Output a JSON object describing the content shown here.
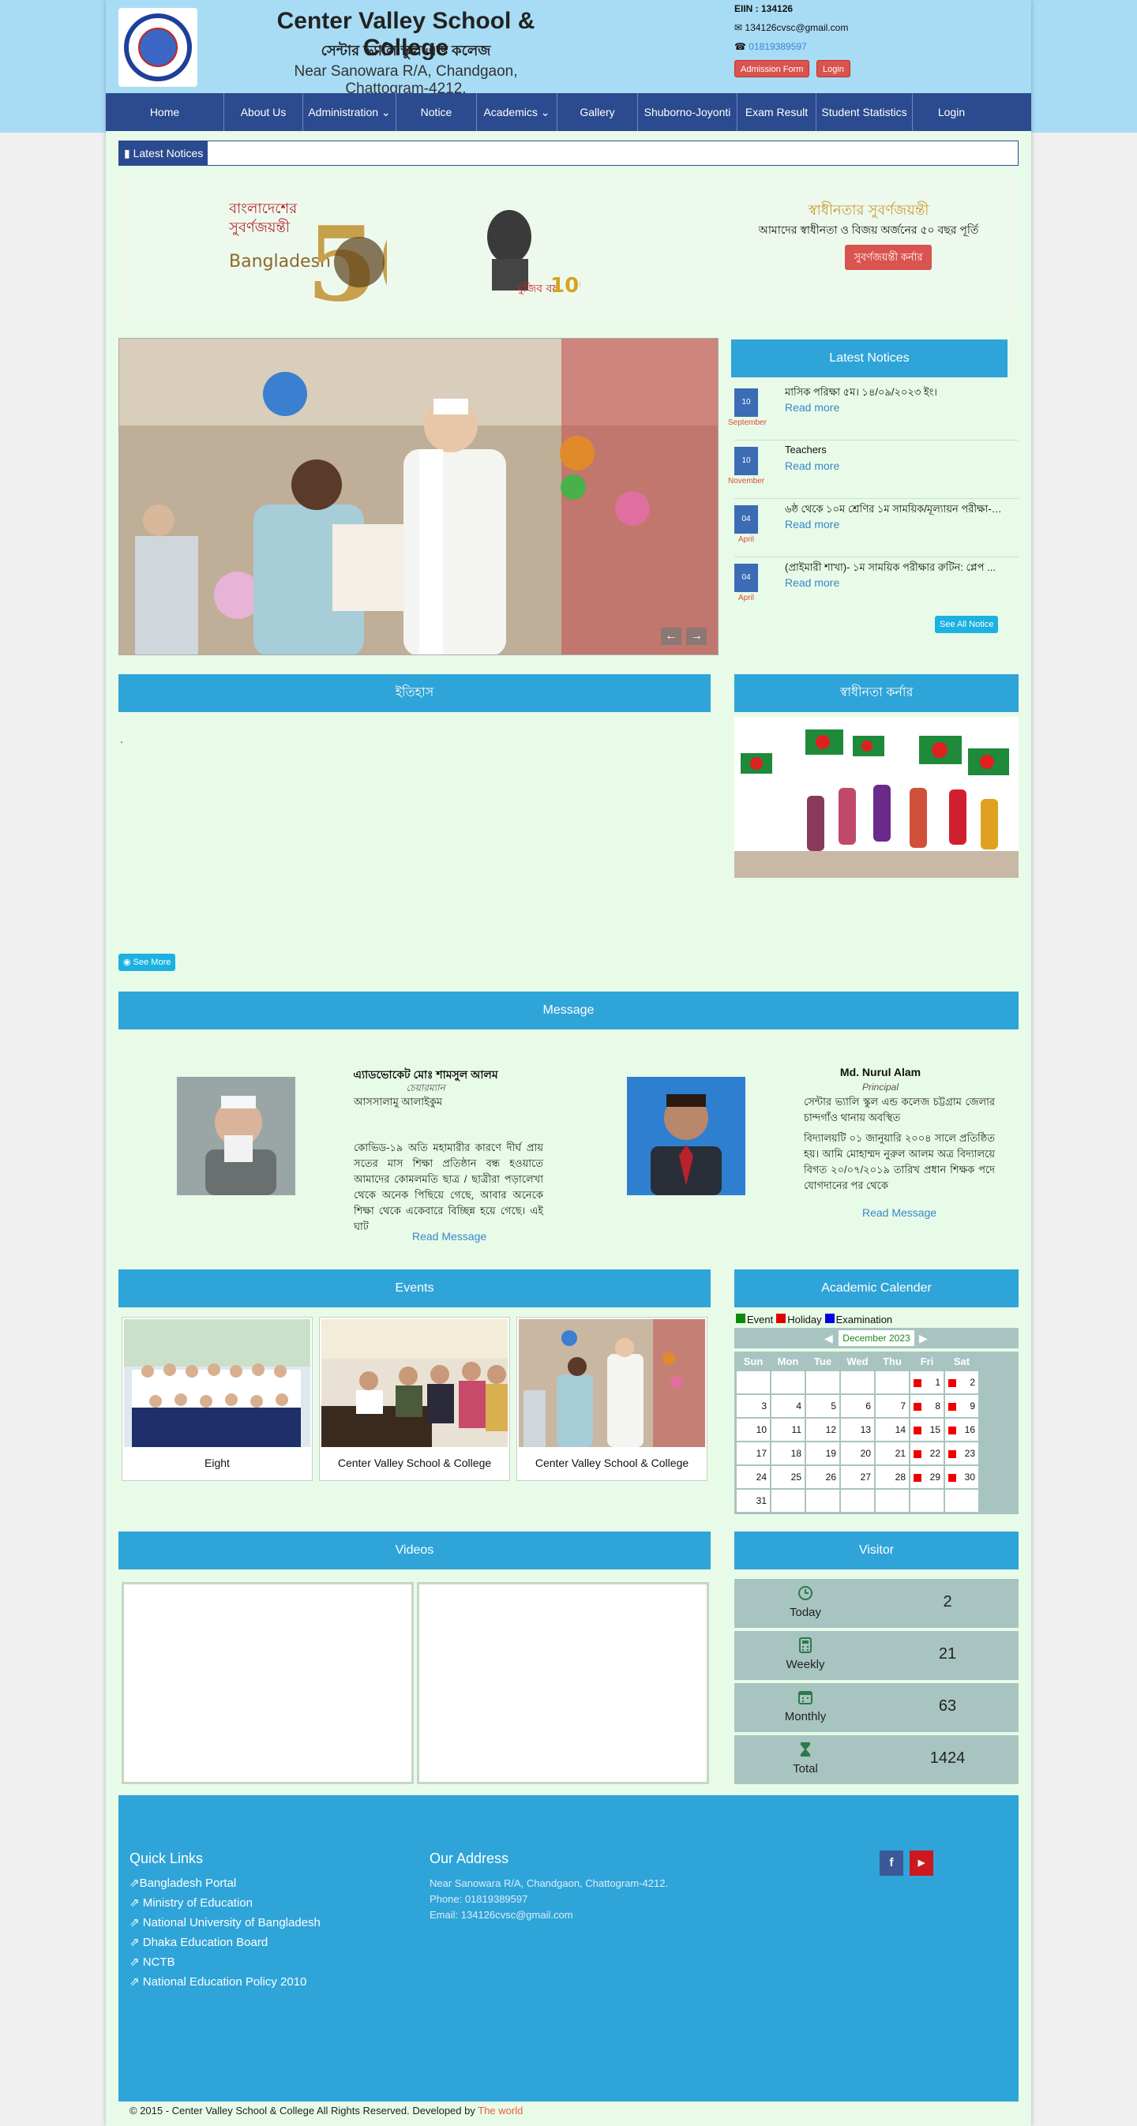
{
  "header": {
    "school_name_en": "Center Valley School & College",
    "school_name_bn": "সেন্টার ভ্যালি স্কুল এন্ড কলেজ",
    "address": "Near Sanowara R/A, Chandgaon, Chattogram-4212.",
    "eiin": "EIIN : 134126",
    "email": "134126cvsc@gmail.com",
    "phone": "01819389597",
    "admission_btn": "Admission Form",
    "login_btn": "Login"
  },
  "nav": [
    {
      "label": "Home"
    },
    {
      "label": "About Us"
    },
    {
      "label": "Administration ⌄"
    },
    {
      "label": "Notice"
    },
    {
      "label": "Academics ⌄"
    },
    {
      "label": "Gallery"
    },
    {
      "label": "Shuborno-Joyonti"
    },
    {
      "label": "Exam Result"
    },
    {
      "label": "Student Statistics"
    },
    {
      "label": "Login"
    }
  ],
  "marquee": {
    "label": "Latest Notices"
  },
  "banner": {
    "bd50_text1": "বাংলাদেশের",
    "bd50_text2": "সুবর্ণজয়ন্তী",
    "bd50_text3": "Bangladesh",
    "bd50_number": "50",
    "mujib_text": "মুজিব বর্ষ",
    "mujib_num": "100",
    "title": "স্বাধীনতার সুবর্ণজয়ন্তী",
    "subtitle": "আমাদের স্বাধীনতা ও বিজয় অর্জনের ৫০ বছর পূর্তি",
    "button": "সুবর্ণজয়ন্তী কর্নার"
  },
  "latest_notices": {
    "title": "Latest Notices",
    "items": [
      {
        "day": "10",
        "month": "September",
        "title": "মাসিক পরিক্ষা ৫ম। ১৪/০৯/২০২৩ ইং।",
        "link": "Read more"
      },
      {
        "day": "10",
        "month": "November",
        "title": "Teachers",
        "link": "Read more"
      },
      {
        "day": "04",
        "month": "April",
        "title": "৬ষ্ঠ থেকে ১০ম শ্রেণির ১ম সাময়িক/মূল্যায়ন পরীক্ষা-২ ...",
        "link": "Read more"
      },
      {
        "day": "04",
        "month": "April",
        "title": "(প্রাইমারী শাখা)- ১ম সাময়িক পরীক্ষার রুটিন: প্লেপ ...",
        "link": "Read more"
      }
    ],
    "see_all": "See All Notice"
  },
  "history": {
    "title": "ইতিহাস",
    "text": ".",
    "see_more": "See More"
  },
  "freedom": {
    "title": "স্বাধীনতা কর্নার"
  },
  "message": {
    "title": "Message",
    "chairman": {
      "name": "এ্যাডভোকেট মোঃ শামসুল আলম",
      "role": "চেয়ারম্যান",
      "greeting": "আসসালামু আলাইকুম",
      "text": "কোভিড-১৯ অতি মহামারীর কারণে দীর্ঘ প্রায় সতের মাস শিক্ষা প্রতিষ্ঠান বন্ধ হওয়াতে আমাদের কোমলমতি ছাত্র / ছাত্রীরা পড়ালেখা থেকে অনেক পিছিয়ে গেছে, আবার অনেকে শিক্ষা থেকে একেবারে বিচ্ছিন্ন হয়ে গেছে। এই ঘাট",
      "link": "Read Message"
    },
    "principal": {
      "name": "Md. Nurul Alam",
      "role": "Principal",
      "intro": "সেন্টার ভ্যালি স্কুল এন্ড কলেজ চট্টগ্রাম জেলার চান্দগাঁও থানায় অবস্থিত",
      "text": "বিদ্যালয়টি ০১ জানুয়ারি ২০০৪ সালে প্রতিষ্ঠিত হয়। আমি মোহাম্মদ নুরুল আলম অত্র বিদ্যালয়ে বিগত ২০/০৭/২০১৯ তারিখ প্রধান শিক্ষক পদে যোগদানের পর থেকে",
      "link": "Read Message"
    }
  },
  "events": {
    "title": "Events",
    "items": [
      {
        "caption": "Eight"
      },
      {
        "caption": "Center Valley School & College"
      },
      {
        "caption": "Center Valley School & College"
      }
    ]
  },
  "calendar": {
    "title": "Academic Calender",
    "legend": [
      {
        "label": "Event",
        "color": "#0a8a0a"
      },
      {
        "label": "Holiday",
        "color": "#e00000"
      },
      {
        "label": "Examination",
        "color": "#0000e0"
      }
    ],
    "month": "December 2023",
    "days": [
      "Sun",
      "Mon",
      "Tue",
      "Wed",
      "Thu",
      "Fri",
      "Sat"
    ],
    "weeks": [
      [
        {
          "d": ""
        },
        {
          "d": ""
        },
        {
          "d": ""
        },
        {
          "d": ""
        },
        {
          "d": ""
        },
        {
          "d": "1",
          "h": true
        },
        {
          "d": "2",
          "h": true
        }
      ],
      [
        {
          "d": "3"
        },
        {
          "d": "4"
        },
        {
          "d": "5"
        },
        {
          "d": "6"
        },
        {
          "d": "7"
        },
        {
          "d": "8",
          "h": true
        },
        {
          "d": "9",
          "h": true
        }
      ],
      [
        {
          "d": "10"
        },
        {
          "d": "11"
        },
        {
          "d": "12"
        },
        {
          "d": "13"
        },
        {
          "d": "14"
        },
        {
          "d": "15",
          "h": true
        },
        {
          "d": "16",
          "h": true
        }
      ],
      [
        {
          "d": "17"
        },
        {
          "d": "18"
        },
        {
          "d": "19"
        },
        {
          "d": "20"
        },
        {
          "d": "21"
        },
        {
          "d": "22",
          "h": true
        },
        {
          "d": "23",
          "h": true
        }
      ],
      [
        {
          "d": "24"
        },
        {
          "d": "25"
        },
        {
          "d": "26"
        },
        {
          "d": "27"
        },
        {
          "d": "28"
        },
        {
          "d": "29",
          "h": true
        },
        {
          "d": "30",
          "h": true
        }
      ],
      [
        {
          "d": "31"
        },
        {
          "d": ""
        },
        {
          "d": ""
        },
        {
          "d": ""
        },
        {
          "d": ""
        },
        {
          "d": ""
        },
        {
          "d": ""
        }
      ]
    ]
  },
  "videos": {
    "title": "Videos"
  },
  "visitor": {
    "title": "Visitor",
    "rows": [
      {
        "label": "Today",
        "value": "2",
        "icon": "clock-icon"
      },
      {
        "label": "Weekly",
        "value": "21",
        "icon": "calculator-icon"
      },
      {
        "label": "Monthly",
        "value": "63",
        "icon": "calendar-icon"
      },
      {
        "label": "Total",
        "value": "1424",
        "icon": "hourglass-icon"
      }
    ]
  },
  "footer": {
    "quick_links_title": "Quick Links",
    "quick_links": [
      "Bangladesh Portal",
      "Ministry of Education",
      "National University of Bangladesh",
      "Dhaka Education Board",
      "NCTB",
      "National Education Policy 2010"
    ],
    "address_title": "Our Address",
    "address": "Near Sanowara R/A, Chandgaon, Chattogram-4212.",
    "phone": "Phone: 01819389597",
    "email": "Email: 134126cvsc@gmail.com",
    "copyright": "© 2015 - Center Valley School & College All Rights Reserved. Developed by",
    "developer": "The world"
  }
}
